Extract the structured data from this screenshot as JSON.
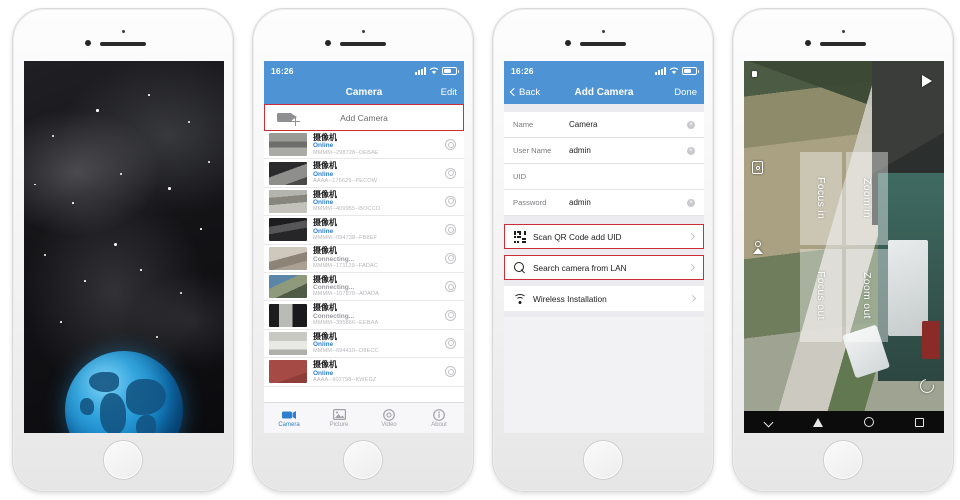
{
  "phone1": {
    "name": "splash-screen",
    "screen_type": "app-launch-splash",
    "background": "#0a0a0c",
    "globe_color": "#1484c8"
  },
  "phone2": {
    "status_bar": {
      "time": "16:26",
      "signal": "signal-bars-icon",
      "wifi": "wifi-icon",
      "battery": "battery-icon"
    },
    "nav": {
      "title": "Camera",
      "right_action": "Edit"
    },
    "add_camera": {
      "label": "Add Camera",
      "icon": "camcorder-plus-icon",
      "highlighted": true
    },
    "cameras": [
      {
        "name": "摄像机",
        "status": "Online",
        "uid": "MMMM--298728--DEBAE",
        "thumb": "street-cars-gray"
      },
      {
        "name": "摄像机",
        "status": "Online",
        "uid": "AAAA--176629--PECOW",
        "thumb": "indoor-dark-gray"
      },
      {
        "name": "摄像机",
        "status": "Online",
        "uid": "MMMM--409955--BOCCO",
        "thumb": "parking-lot-gray"
      },
      {
        "name": "摄像机",
        "status": "Online",
        "uid": "MMMM--094738--FB8EF",
        "thumb": "corridor-dark"
      },
      {
        "name": "摄像机",
        "status": "Connecting...",
        "uid": "MMMM--171129--FADAC",
        "thumb": "living-room"
      },
      {
        "name": "摄像机",
        "status": "Connecting...",
        "uid": "MMMM--107878--ADADA",
        "thumb": "blue-ceiling"
      },
      {
        "name": "摄像机",
        "status": "Connecting...",
        "uid": "MMMM--395866--EEBAA",
        "thumb": "doorway-dark"
      },
      {
        "name": "摄像机",
        "status": "Online",
        "uid": "MMMM--694410--D8ECC",
        "thumb": "snow-ground"
      },
      {
        "name": "摄像机",
        "status": "Online",
        "uid": "AAAA--902798--KWEGZ",
        "thumb": "red-carpet"
      }
    ],
    "tabs": [
      {
        "label": "Camera",
        "icon": "camcorder-icon",
        "active": true
      },
      {
        "label": "Picture",
        "icon": "picture-icon",
        "active": false
      },
      {
        "label": "Video",
        "icon": "video-icon",
        "active": false
      },
      {
        "label": "About",
        "icon": "info-icon",
        "active": false
      }
    ],
    "accent_color": "#2f7fd0",
    "highlight_color": "#cf2c3a"
  },
  "phone3": {
    "status_bar": {
      "time": "16:26"
    },
    "nav": {
      "back": "Back",
      "title": "Add Camera",
      "done": "Done"
    },
    "fields": [
      {
        "label": "Name",
        "value": "Camera",
        "clearable": true
      },
      {
        "label": "User Name",
        "value": "admin",
        "clearable": true
      },
      {
        "label": "UID",
        "value": "",
        "clearable": false
      },
      {
        "label": "Password",
        "value": "admin",
        "clearable": true
      }
    ],
    "actions": [
      {
        "label": "Scan QR Code add UID",
        "icon": "qr-code-icon",
        "highlighted": true
      },
      {
        "label": "Search camera from LAN",
        "icon": "search-icon",
        "highlighted": true
      },
      {
        "label": "Wireless Installation",
        "icon": "wifi-icon",
        "highlighted": false
      }
    ]
  },
  "phone4": {
    "screen_type": "live-view-landscape",
    "ptz_buttons": [
      {
        "label": "Focus in"
      },
      {
        "label": "Zoom in"
      },
      {
        "label": "Focus out"
      },
      {
        "label": "Zoom out"
      }
    ],
    "overlay_icons": [
      "speaker-icon",
      "snapshot-icon",
      "record-icon",
      "flag-icon",
      "play-icon",
      "refresh-icon"
    ],
    "android_nav": [
      "collapse-icon",
      "back-icon",
      "home-icon",
      "recents-icon"
    ]
  }
}
